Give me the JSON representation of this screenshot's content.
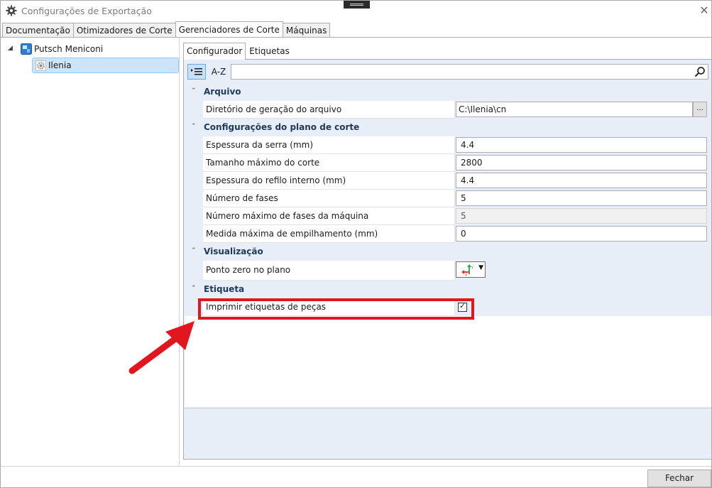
{
  "window": {
    "title": "Configurações de Exportação"
  },
  "main_tabs": [
    {
      "label": "Documentação"
    },
    {
      "label": "Otimizadores de Corte"
    },
    {
      "label": "Gerenciadores de Corte"
    },
    {
      "label": "Máquinas"
    }
  ],
  "active_main_tab": "Gerenciadores de Corte",
  "tree": {
    "root": {
      "label": "Putsch Meniconi",
      "icon": "machine-icon"
    },
    "child": {
      "label": "Ilenia",
      "icon": "gear-icon"
    }
  },
  "sub_tabs": [
    {
      "label": "Configurador"
    },
    {
      "label": "Etiquetas"
    }
  ],
  "toolbar": {
    "sorted_label": "",
    "az_label": "A-Z",
    "search_placeholder": ""
  },
  "categories": [
    {
      "label": "Arquivo",
      "properties": [
        {
          "name": "Diretório de geração do arquivo",
          "value": "C:\\Ilenia\\cn"
        }
      ]
    },
    {
      "label": "Configurações do plano de corte",
      "properties": [
        {
          "name": "Espessura da serra (mm)",
          "value": "4.4"
        },
        {
          "name": "Tamanho máximo do corte",
          "value": "2800"
        },
        {
          "name": "Espessura do refilo interno (mm)",
          "value": "4.4"
        },
        {
          "name": "Número de fases",
          "value": "5"
        },
        {
          "name": "Número máximo de fases da máquina",
          "value": "5"
        },
        {
          "name": "Medida máxima de empilhamento (mm)",
          "value": "0"
        }
      ]
    },
    {
      "label": "Visualização",
      "properties": [
        {
          "name": "Ponto zero no plano",
          "value": ""
        }
      ]
    },
    {
      "label": "Etiqueta",
      "properties": [
        {
          "name": "Imprimir etiquetas de peças",
          "checked": true
        }
      ]
    }
  ],
  "ellipsis_label": "...",
  "footer": {
    "close_label": "Fechar"
  },
  "colors": {
    "highlight": "#e2161e",
    "selection": "#cce4f7",
    "category_bg": "#e8eef7"
  }
}
